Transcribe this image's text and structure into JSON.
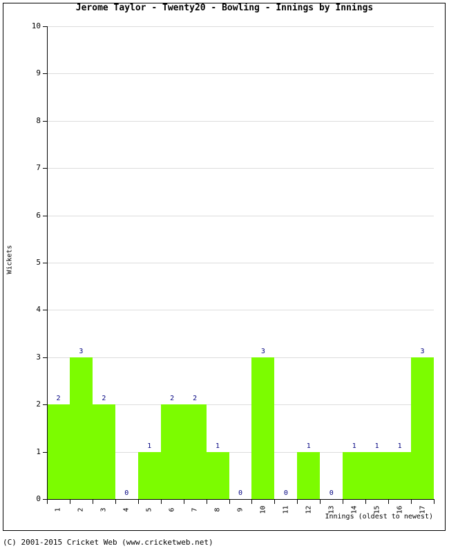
{
  "chart_data": {
    "type": "bar",
    "title": "Jerome Taylor - Twenty20 - Bowling - Innings by Innings",
    "xlabel": "Innings (oldest to newest)",
    "ylabel": "Wickets",
    "categories": [
      "1",
      "2",
      "3",
      "4",
      "5",
      "6",
      "7",
      "8",
      "9",
      "10",
      "11",
      "12",
      "13",
      "14",
      "15",
      "16",
      "17"
    ],
    "values": [
      2,
      3,
      2,
      0,
      1,
      2,
      2,
      1,
      0,
      3,
      0,
      1,
      0,
      1,
      1,
      1,
      3
    ],
    "value_labels": [
      "2",
      "3",
      "2",
      "0",
      "1",
      "2",
      "2",
      "1",
      "0",
      "3",
      "0",
      "1",
      "0",
      "1",
      "1",
      "1",
      "3"
    ],
    "ylim": [
      0,
      10
    ],
    "ytick_labels": [
      "0",
      "1",
      "2",
      "3",
      "4",
      "5",
      "6",
      "7",
      "8",
      "9",
      "10"
    ],
    "ytick_values": [
      0,
      1,
      2,
      3,
      4,
      5,
      6,
      7,
      8,
      9,
      10
    ],
    "grid": true,
    "legend": "none",
    "bar_color": "#7cfc00",
    "value_label_color": "#000080",
    "grid_color": "#dcdcdc",
    "axis_color": "#000000"
  },
  "footer": {
    "copyright": "(C) 2001-2015 Cricket Web (www.cricketweb.net)"
  }
}
